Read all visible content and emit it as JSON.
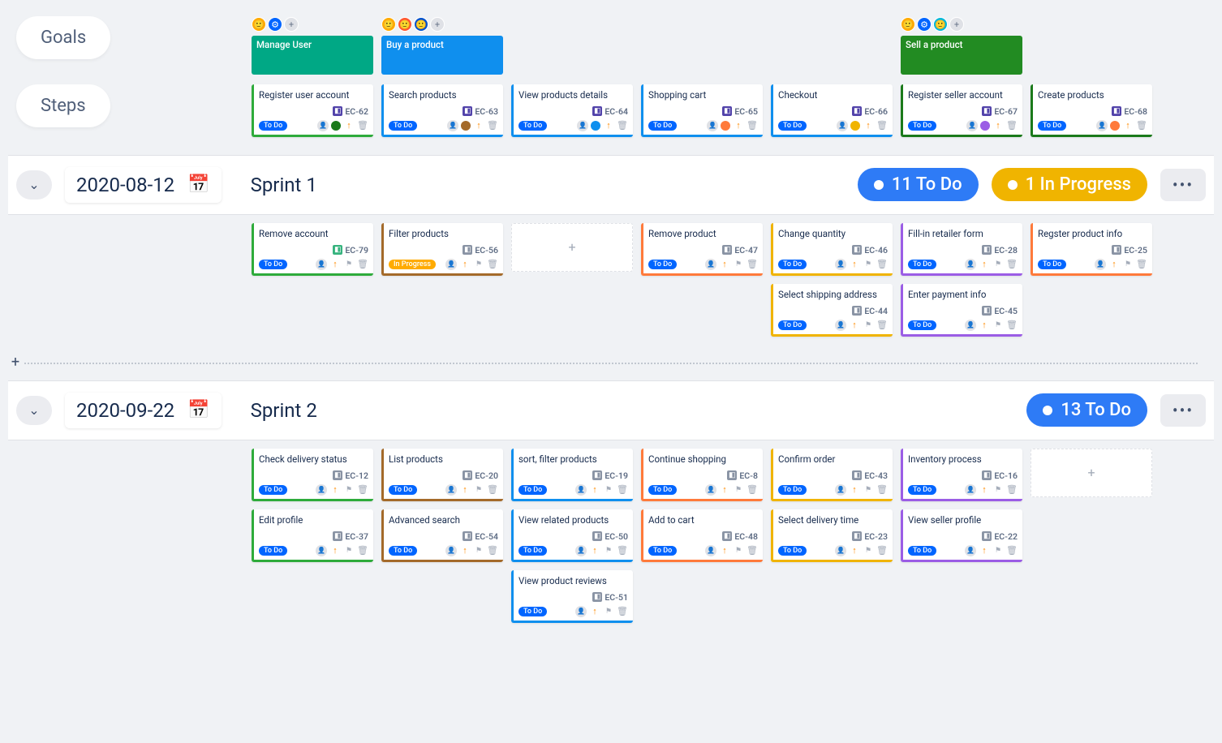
{
  "labels": {
    "goals": "Goals",
    "steps": "Steps"
  },
  "status_labels": {
    "todo": "To Do",
    "inprogress": "In Progress"
  },
  "colors": {
    "teal": "#00a885",
    "blue": "#0f8fee",
    "forest": "#228b22",
    "green": "#2eab3b",
    "darkgreen": "#1b7a1b",
    "brown": "#a46a2a",
    "orange": "#ff7a3b",
    "yellow": "#f0b400",
    "purple": "#9b5de5"
  },
  "goals": [
    {
      "col": 0,
      "title": "Manage User",
      "bg": "teal",
      "avatars": [
        "face1",
        "gear",
        "add"
      ]
    },
    {
      "col": 1,
      "title": "Buy a product",
      "bg": "blue",
      "avatars": [
        "face1",
        "face2",
        "face3",
        "add"
      ]
    },
    {
      "col": 5,
      "title": "Sell a product",
      "bg": "forest",
      "avatars": [
        "face1",
        "gear",
        "face4",
        "add"
      ]
    }
  ],
  "steps": [
    {
      "col": 0,
      "title": "Register user account",
      "key": "EC-62",
      "keyColor": "#5243aa",
      "accent": "green",
      "dot": "darkgreen"
    },
    {
      "col": 1,
      "title": "Search products",
      "key": "EC-63",
      "keyColor": "#5243aa",
      "accent": "blue",
      "dot": "brown"
    },
    {
      "col": 2,
      "title": "View products details",
      "key": "EC-64",
      "keyColor": "#5243aa",
      "accent": "blue",
      "dot": "blue"
    },
    {
      "col": 3,
      "title": "Shopping cart",
      "key": "EC-65",
      "keyColor": "#5243aa",
      "accent": "blue",
      "dot": "orange"
    },
    {
      "col": 4,
      "title": "Checkout",
      "key": "EC-66",
      "keyColor": "#5243aa",
      "accent": "blue",
      "dot": "yellow"
    },
    {
      "col": 5,
      "title": "Register seller account",
      "key": "EC-67",
      "keyColor": "#5243aa",
      "accent": "darkgreen",
      "dot": "purple"
    },
    {
      "col": 6,
      "title": "Create products",
      "key": "EC-68",
      "keyColor": "#5243aa",
      "accent": "darkgreen",
      "dot": "orange"
    }
  ],
  "sprints": [
    {
      "date": "2020-08-12",
      "name": "Sprint 1",
      "pills": [
        {
          "text": "11 To Do",
          "cls": "count-blue"
        },
        {
          "text": "1 In Progress",
          "cls": "count-yellow"
        }
      ],
      "rows": [
        [
          {
            "title": "Remove account",
            "key": "EC-79",
            "keyColor": "#36b37e",
            "accent": "green",
            "status": "todo"
          },
          {
            "title": "Filter products",
            "key": "EC-56",
            "keyColor": "#8993a4",
            "accent": "brown",
            "status": "inprogress"
          },
          {
            "placeholder": true
          },
          {
            "title": "Remove product",
            "key": "EC-47",
            "keyColor": "#8993a4",
            "accent": "orange",
            "status": "todo"
          },
          {
            "title": "Change quantity",
            "key": "EC-46",
            "keyColor": "#8993a4",
            "accent": "yellow",
            "status": "todo"
          },
          {
            "title": "Fill-in retailer form",
            "key": "EC-28",
            "keyColor": "#8993a4",
            "accent": "purple",
            "status": "todo"
          },
          {
            "title": "Regster product info",
            "key": "EC-25",
            "keyColor": "#8993a4",
            "accent": "orange",
            "status": "todo"
          }
        ],
        [
          null,
          null,
          null,
          null,
          {
            "title": "Select shipping address",
            "key": "EC-44",
            "keyColor": "#8993a4",
            "accent": "yellow",
            "status": "todo"
          },
          {
            "title": "Enter payment info",
            "key": "EC-45",
            "keyColor": "#8993a4",
            "accent": "purple",
            "status": "todo"
          },
          null
        ]
      ]
    },
    {
      "date": "2020-09-22",
      "name": "Sprint 2",
      "pills": [
        {
          "text": "13 To Do",
          "cls": "count-blue"
        }
      ],
      "rows": [
        [
          {
            "title": "Check delivery status",
            "key": "EC-12",
            "keyColor": "#8993a4",
            "accent": "green",
            "status": "todo"
          },
          {
            "title": "List products",
            "key": "EC-20",
            "keyColor": "#8993a4",
            "accent": "brown",
            "status": "todo"
          },
          {
            "title": "sort, filter products",
            "key": "EC-19",
            "keyColor": "#8993a4",
            "accent": "blue",
            "status": "todo"
          },
          {
            "title": "Continue shopping",
            "key": "EC-8",
            "keyColor": "#8993a4",
            "accent": "orange",
            "status": "todo"
          },
          {
            "title": "Confirm order",
            "key": "EC-43",
            "keyColor": "#8993a4",
            "accent": "yellow",
            "status": "todo"
          },
          {
            "title": "Inventory process",
            "key": "EC-16",
            "keyColor": "#8993a4",
            "accent": "purple",
            "status": "todo"
          },
          {
            "placeholder": true
          }
        ],
        [
          {
            "title": "Edit profile",
            "key": "EC-37",
            "keyColor": "#8993a4",
            "accent": "green",
            "status": "todo"
          },
          {
            "title": "Advanced search",
            "key": "EC-54",
            "keyColor": "#8993a4",
            "accent": "brown",
            "status": "todo"
          },
          {
            "title": "View related products",
            "key": "EC-50",
            "keyColor": "#8993a4",
            "accent": "blue",
            "status": "todo"
          },
          {
            "title": "Add to cart",
            "key": "EC-48",
            "keyColor": "#8993a4",
            "accent": "orange",
            "status": "todo"
          },
          {
            "title": "Select delivery time",
            "key": "EC-23",
            "keyColor": "#8993a4",
            "accent": "yellow",
            "status": "todo"
          },
          {
            "title": "View seller profile",
            "key": "EC-22",
            "keyColor": "#8993a4",
            "accent": "purple",
            "status": "todo"
          },
          null
        ],
        [
          null,
          null,
          {
            "title": "View product reviews",
            "key": "EC-51",
            "keyColor": "#8993a4",
            "accent": "blue",
            "status": "todo"
          },
          null,
          null,
          null,
          null
        ]
      ]
    }
  ]
}
